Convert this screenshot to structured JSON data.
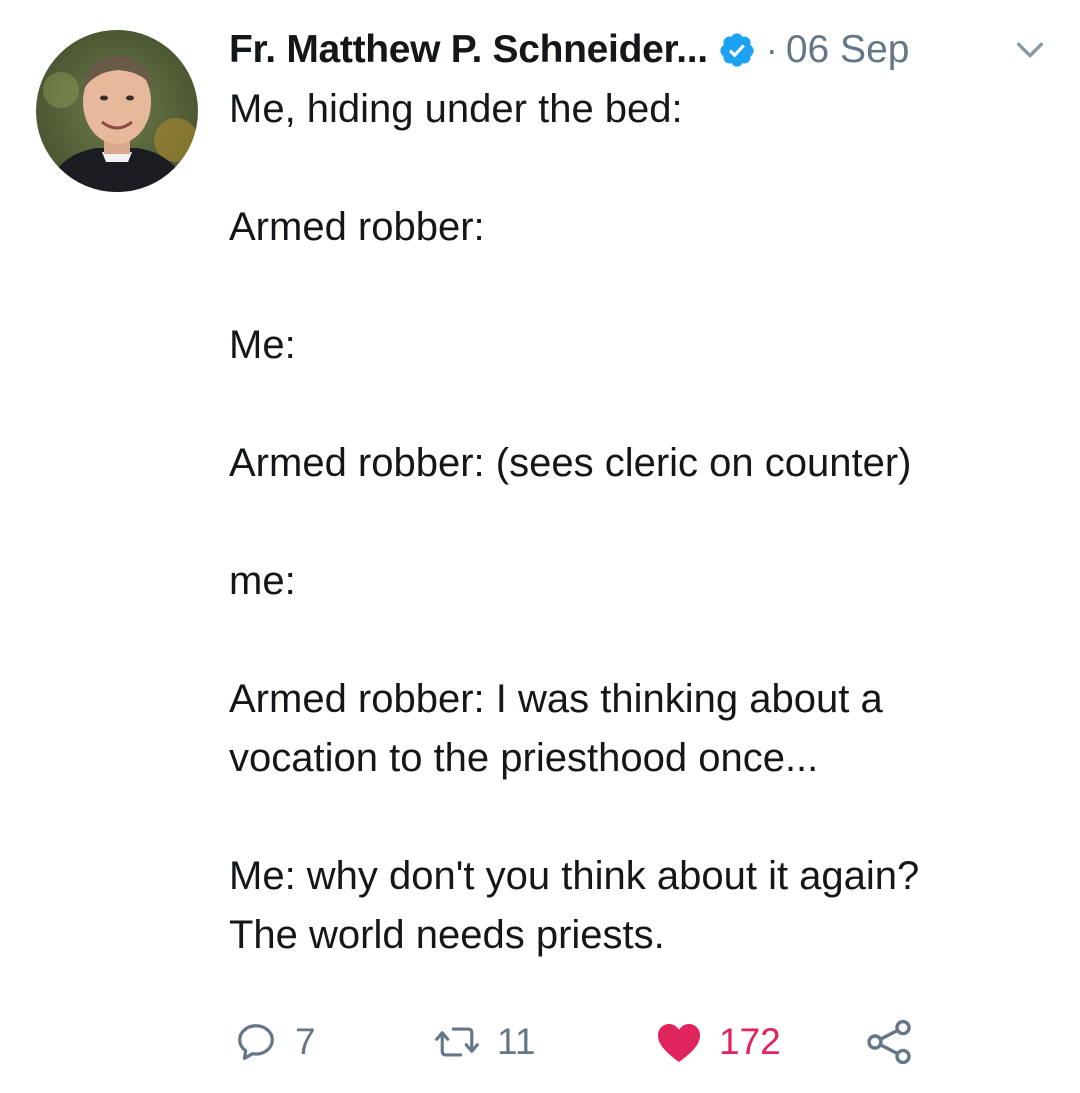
{
  "tweet": {
    "author_name": "Fr. Matthew P. Schneider...",
    "separator": "·",
    "date": "06 Sep",
    "lines": [
      "Me, hiding under the bed:",
      "",
      "Armed robber:",
      "",
      "Me:",
      "",
      "Armed robber: (sees cleric on counter)",
      "",
      "me:",
      "",
      "Armed robber: I was thinking about a",
      "vocation to the priesthood once...",
      "",
      "Me: why don't you think about it again?",
      "The world needs priests."
    ]
  },
  "actions": {
    "reply_count": "7",
    "retweet_count": "11",
    "like_count": "172"
  },
  "colors": {
    "text": "#14171a",
    "secondary": "#657786",
    "verified": "#1da1f2",
    "like": "#e0245e"
  },
  "icons": [
    "avatar",
    "verified-badge-icon",
    "chevron-down-icon",
    "reply-icon",
    "retweet-icon",
    "heart-icon",
    "share-icon"
  ]
}
